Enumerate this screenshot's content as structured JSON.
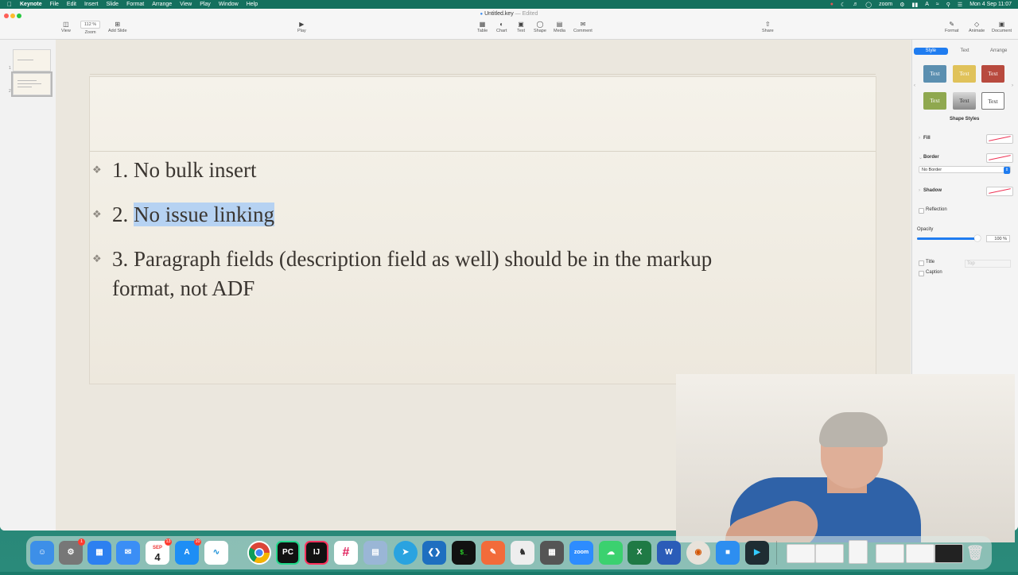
{
  "menubar": {
    "app": "Keynote",
    "items": [
      "File",
      "Edit",
      "Insert",
      "Slide",
      "Format",
      "Arrange",
      "View",
      "Play",
      "Window",
      "Help"
    ],
    "status_zoom": "zoom",
    "clock": "Mon 4 Sep 11:07"
  },
  "window": {
    "title": "Untitled.key",
    "edited": "— Edited"
  },
  "toolbar": {
    "view": "View",
    "zoom_value": "112 %",
    "zoom": "Zoom",
    "add_slide": "Add Slide",
    "play": "Play",
    "table": "Table",
    "chart": "Chart",
    "text": "Text",
    "shape": "Shape",
    "media": "Media",
    "comment": "Comment",
    "share": "Share",
    "format": "Format",
    "animate": "Animate",
    "document": "Document"
  },
  "navigator": {
    "slides": [
      "1",
      "2"
    ],
    "selected": 2
  },
  "slide": {
    "bullets": [
      {
        "num": "1.",
        "text": "No bulk insert"
      },
      {
        "num": "2.",
        "text": "No issue linking"
      },
      {
        "num": "3.",
        "text": "Paragraph fields (description field as well) should be in the markup",
        "text2": "format, not ADF"
      }
    ]
  },
  "inspector": {
    "tabs": [
      "Style",
      "Text",
      "Arrange"
    ],
    "active_tab": "Style",
    "swatch_label": "Text",
    "swatch_colors": [
      "#5b8fb0",
      "#e0c25a",
      "#b84a3e",
      "#8fa84f",
      "#9a9a9a",
      "#ffffff"
    ],
    "shape_styles": "Shape Styles",
    "fill": "Fill",
    "border": "Border",
    "border_value": "No Border",
    "shadow": "Shadow",
    "reflection": "Reflection",
    "opacity": "Opacity",
    "opacity_value": "100 %",
    "opacity_level": 1.0,
    "title": "Title",
    "title_pos": "Top",
    "caption": "Caption"
  },
  "dock": {
    "badges": {
      "settings": "1",
      "calendar_month": "SEP",
      "calendar_day": "4",
      "calendar_badge": "13",
      "appstore": "10"
    },
    "labels": {
      "pycharm": "PC",
      "intellij": "IJ",
      "zoom": "zoom",
      "excel": "X",
      "word": "W"
    }
  }
}
